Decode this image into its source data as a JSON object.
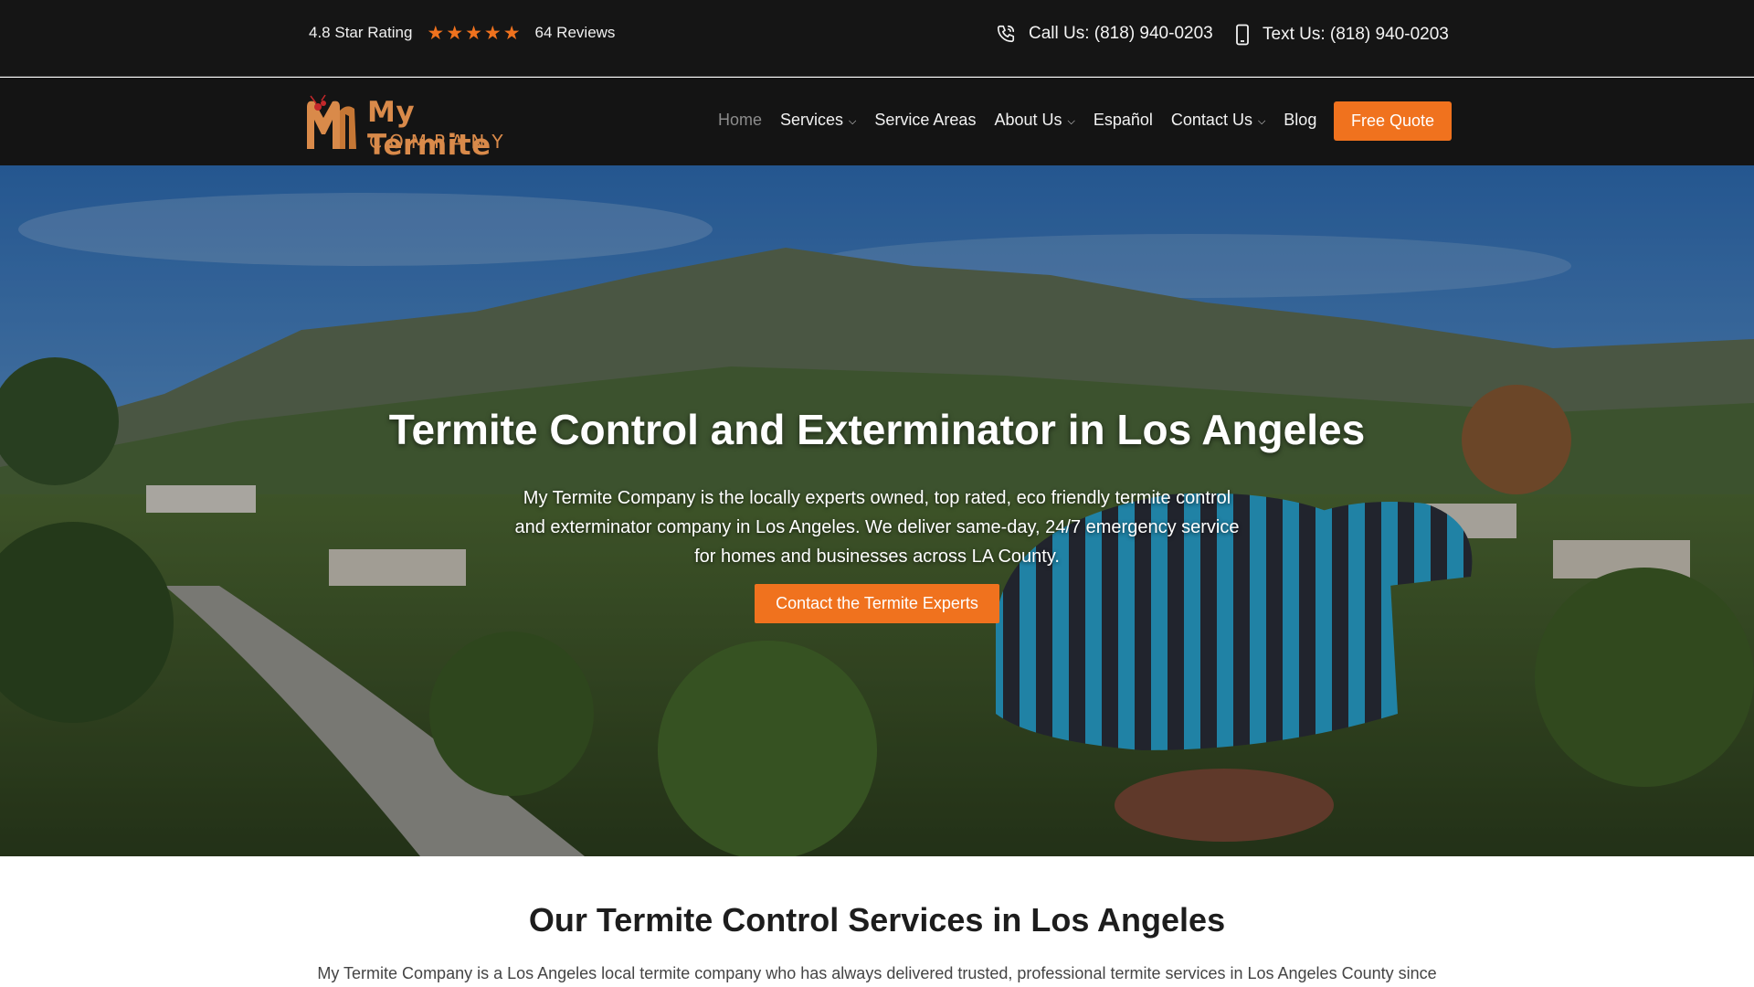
{
  "topbar": {
    "rating_label": "4.8 Star Rating",
    "stars": 5,
    "reviews_label": "64 Reviews",
    "call_label": "Call Us: (818) 940-0203",
    "text_label": "Text Us: (818) 940-0203",
    "star_color": "#f0721e"
  },
  "logo": {
    "line1": "My Termite",
    "line2": "COMPANY",
    "color": "#d98a4a"
  },
  "nav": {
    "home": "Home",
    "services": "Services",
    "service_areas": "Service Areas",
    "about": "About Us",
    "espanol": "Español",
    "contact": "Contact Us",
    "blog": "Blog",
    "quote": "Free Quote",
    "chevron": "⌵"
  },
  "hero": {
    "title": "Termite Control and Exterminator in Los Angeles",
    "text": "My Termite Company is the locally experts owned, top rated, eco friendly termite control and exterminator company in Los Angeles. We deliver same-day, 24/7 emergency service for homes and businesses across LA County.",
    "cta": "Contact the Termite Experts",
    "accent": "#f0721e"
  },
  "services_section": {
    "title": "Our Termite Control Services in Los Angeles",
    "text": "My Termite Company is a Los Angeles local termite company who has always delivered trusted, professional termite services in Los Angeles County since"
  }
}
